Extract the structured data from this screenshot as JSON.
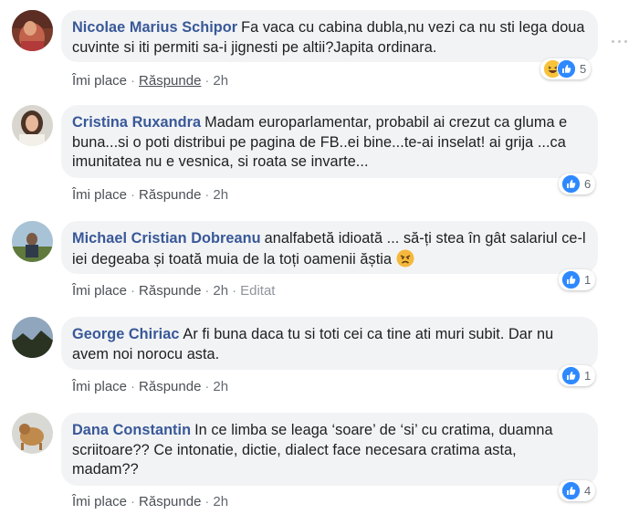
{
  "actions": {
    "like": "Îmi place",
    "reply": "Răspunde",
    "sep": "·"
  },
  "comments": [
    {
      "author": "Nicolae Marius Schipor",
      "text": "Fa vaca cu cabina dubla,nu vezi ca nu sti lega doua cuvinte si iti permiti sa-i jignesti pe altii?Japita ordinara.",
      "time": "2h",
      "reaction_count": "5",
      "reactions": [
        "haha",
        "like"
      ]
    },
    {
      "author": "Cristina Ruxandra",
      "text": "Madam europarlamentar, probabil ai crezut ca gluma e buna...si o poti distribui pe pagina de FB..ei bine...te-ai inselat! ai grija ...ca imunitatea nu e vesnica, si roata se invarte...",
      "time": "2h",
      "reaction_count": "6",
      "reactions": [
        "like"
      ]
    },
    {
      "author": "Michael Cristian Dobreanu",
      "text": "analfabetă idioată ... să-ți stea în gât salariul ce-l iei degeaba și toată muia de la toți oamenii ăștia",
      "time": "2h",
      "edited": "Editat",
      "reaction_count": "1",
      "reactions": [
        "like"
      ]
    },
    {
      "author": "George Chiriac",
      "text": "Ar fi buna daca tu si toti cei ca tine ati muri subit. Dar nu avem noi norocu asta.",
      "time": "2h",
      "reaction_count": "1",
      "reactions": [
        "like"
      ]
    },
    {
      "author": "Dana Constantin",
      "text": "In ce limba se leaga ‘soare’ de ‘si’ cu cratima, duamna scriitoare?? Ce intonatie, dictie, dialect face necesara cratima asta, madam??",
      "time": "2h",
      "reaction_count": "4",
      "reactions": [
        "like"
      ]
    }
  ],
  "colors": {
    "author": "#385898",
    "bubble": "#f2f3f5",
    "like_blue": "#2e89ff",
    "meta": "#616770"
  }
}
